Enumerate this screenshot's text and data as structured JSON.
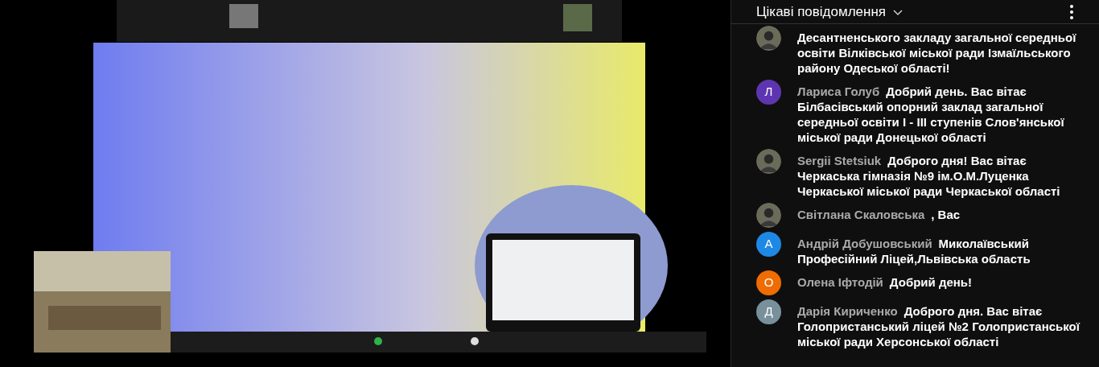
{
  "chat": {
    "title": "Цікаві повідомлення",
    "messages": [
      {
        "text": "Десантненського закладу загальної середньої освіти Вілківської міської ради Ізмаїльського району Одеської області!"
      },
      {
        "kind": "letter",
        "initial": "Л",
        "color": "#5e35b1",
        "author": "Лариса Голуб",
        "text": "Добрий день. Вас вітає Білбасівський опорний заклад загальної середньої освіти І - ІІІ ступенів Слов'янської міської ради Донецької області"
      },
      {
        "author": "Sergii Stetsiuk",
        "text": "Доброго дня! Вас вітає Черкаська гімназія №9 ім.О.М.Луценка Черкаської міської ради Черкаської області"
      },
      {
        "author": "Світлана Скаловська",
        "text": ", Вас"
      },
      {
        "kind": "letter",
        "initial": "А",
        "color": "#1e88e5",
        "author": "Андрій Добушовський",
        "text": "Миколаївський Професійний Ліцей,Львівська область"
      },
      {
        "kind": "letter",
        "initial": "О",
        "color": "#ef6c00",
        "author": "Олена Іфтодій",
        "text": "Добрий день!"
      },
      {
        "kind": "letter",
        "initial": "Д",
        "color": "#78909c",
        "author": "Дарія Кириченко",
        "text": "Доброго дня. Вас вітає Голопристанський ліцей №2 Голопристанської міської ради Херсонської області"
      }
    ]
  }
}
